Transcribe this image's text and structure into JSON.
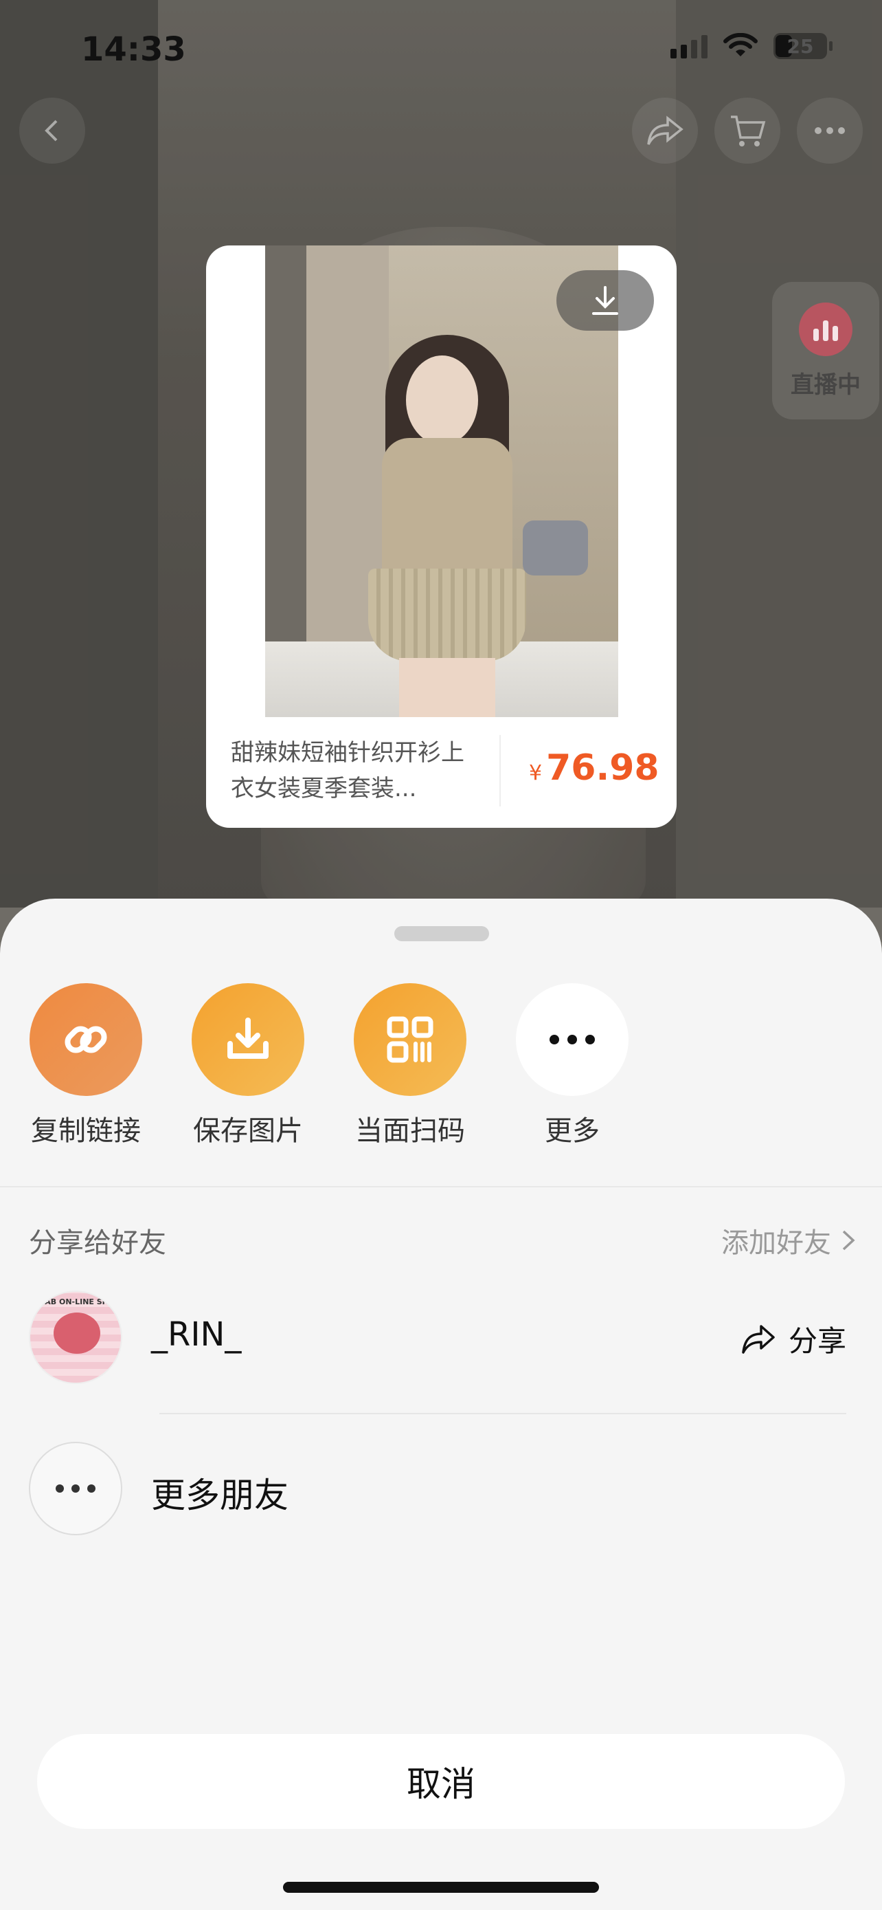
{
  "status_bar": {
    "time": "14:33",
    "battery": "25"
  },
  "live_badge": {
    "label": "直播中"
  },
  "product": {
    "title": "甜辣妹短袖针织开衫上衣女装夏季套装...",
    "currency": "¥",
    "price": "76.98",
    "price_color": "#ef5a24"
  },
  "share_actions": [
    {
      "label": "复制链接",
      "icon": "link-icon"
    },
    {
      "label": "保存图片",
      "icon": "download-icon"
    },
    {
      "label": "当面扫码",
      "icon": "qr-code-icon"
    },
    {
      "label": "更多",
      "icon": "more-dots-icon"
    }
  ],
  "share_section": {
    "title": "分享给好友",
    "add_friend": "添加好友"
  },
  "friends": [
    {
      "name": "_RIN_",
      "action": "分享",
      "avatar_text": "CRAB ON-LINE SHOP"
    }
  ],
  "more_friends": {
    "label": "更多朋友"
  },
  "cancel": {
    "label": "取消"
  }
}
